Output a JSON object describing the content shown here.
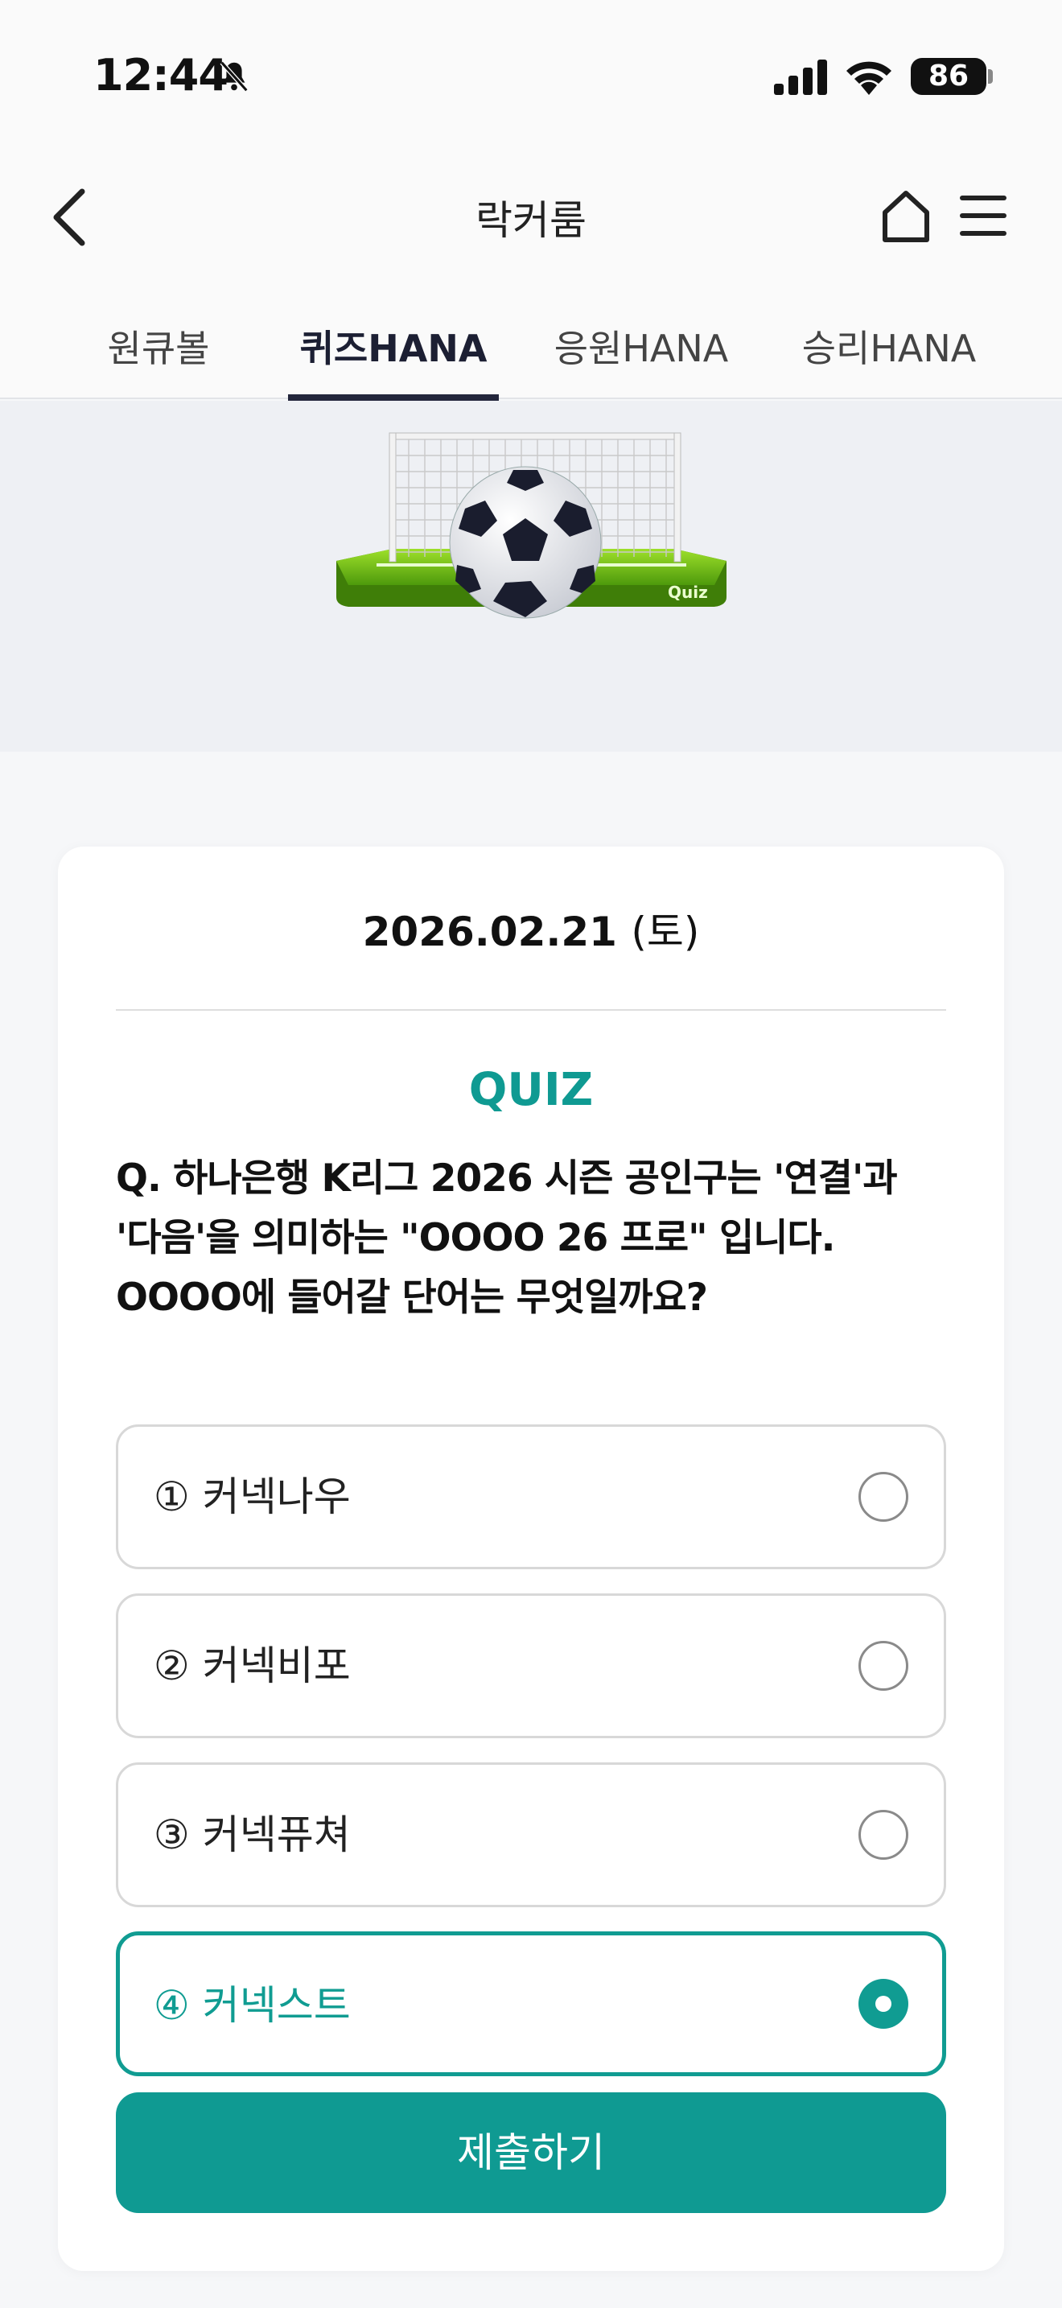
{
  "status_bar": {
    "time": "12:44",
    "battery": "86",
    "icons": [
      "bell-slash-icon",
      "cellular-signal-icon",
      "wifi-icon",
      "battery-icon"
    ]
  },
  "header": {
    "title": "락커룸",
    "icons": [
      "chevron-left-icon",
      "home-icon",
      "hamburger-menu-icon"
    ]
  },
  "tabs": [
    {
      "label": "원큐볼",
      "active": false
    },
    {
      "label": "퀴즈HANA",
      "active": true
    },
    {
      "label": "응원HANA",
      "active": false
    },
    {
      "label": "승리HANA",
      "active": false
    }
  ],
  "banner": {
    "badge_text": "Quiz",
    "illustration": "soccer-goal-with-ball"
  },
  "quiz": {
    "date": "2026.02.21",
    "day_of_week": "(토)",
    "label": "QUIZ",
    "question_lines": [
      "Q. 하나은행 K리그 2026 시즌 공인구는 '연결'과",
      "'다음'을 의미하는 \"OOOO 26 프로\" 입니다.",
      "OOOO에 들어갈 단어는 무엇일까요?"
    ],
    "options": [
      {
        "label": "① 커넥나우",
        "selected": false
      },
      {
        "label": "② 커넥비포",
        "selected": false
      },
      {
        "label": "③ 커넥퓨쳐",
        "selected": false
      },
      {
        "label": "④ 커넥스트",
        "selected": true
      }
    ],
    "submit_label": "제출하기"
  },
  "colors": {
    "accent": "#0f9a92",
    "tab_active": "#23263c",
    "banner_bg": "#eef0f4",
    "page_bg": "#f6f7f9"
  }
}
